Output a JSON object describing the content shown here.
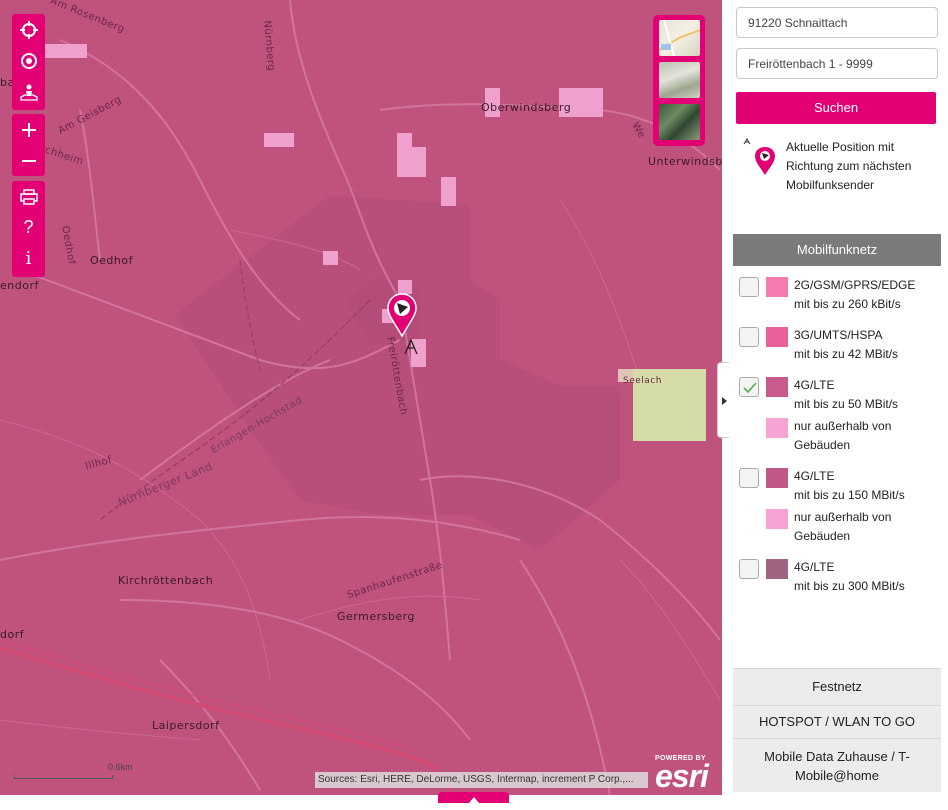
{
  "map": {
    "labels": {
      "am_rosenberg": "Am Rosenberg",
      "am_geisberg": "Am Geisberg",
      "nurnberg_top": "Nürnberg",
      "oberwindsberg": "Oberwindsberg",
      "unterwindsberg": "Unterwindsb",
      "we": "We",
      "oedhof_road": "Oedhof",
      "oedhof": "Oedhof",
      "endorf": "endorf",
      "freirottenbach": "Freiröttenbach",
      "seelach": "Seelach",
      "erlangen_hochstad": "Erlangen-Hochstad",
      "nurnberger_land": "Nürnberger Land",
      "illhof": "Illhof",
      "kirchrottenbach": "Kirchröttenbach",
      "spanhaufenstrasse": "Spanhaufenstraße",
      "germersberg": "Germersberg",
      "dorf": "dorf",
      "laipersdorf": "Laipersdorf",
      "bac": "bac",
      "rchheim": "rchheim"
    },
    "scale_label": "0.6km",
    "attribution": "Sources: Esri, HERE, DeLorme, USGS, Intermap, increment P Corp.,...",
    "esri_powered": "POWERED BY",
    "esri_logo": "esri",
    "controls": {
      "icons": [
        "locate-crosshair-icon",
        "target-icon",
        "map-person-icon",
        "zoom-in-icon",
        "zoom-out-icon",
        "print-icon",
        "help-icon",
        "info-icon"
      ],
      "help_glyph": "?",
      "info_glyph": "i"
    },
    "colors": {
      "coverage": "#c0527e",
      "highlight": "#f0a0cc",
      "seelach": "#d6dca8",
      "accent": "#e20074"
    }
  },
  "panel": {
    "search_value": "91220 Schnaittach",
    "street_value": "Freiröttenbach 1 - 9999",
    "search_button": "Suchen",
    "info_text": "Aktuelle Position mit Richtung zum nächsten Mobilfunksender",
    "section_title": "Mobilfunknetz",
    "legend": [
      {
        "title": "2G/GSM/GPRS/EDGE",
        "detail": "mit bis zu 260 kBit/s",
        "color": "#f57ab0",
        "checked": false
      },
      {
        "title": "3G/UMTS/HSPA",
        "detail": "mit bis zu 42 MBit/s",
        "color": "#e8609c",
        "checked": false
      },
      {
        "title": "4G/LTE",
        "detail": "mit bis zu 50 MBit/s",
        "color": "#c85b8e",
        "checked": true,
        "sub": "nur außerhalb von Gebäuden",
        "sub_color": "#f7a4d4"
      },
      {
        "title": "4G/LTE",
        "detail": "mit bis zu 150 MBit/s",
        "color": "#c2578a",
        "checked": false,
        "sub": "nur außerhalb von Gebäuden",
        "sub_color": "#f7a4d4"
      },
      {
        "title": "4G/LTE",
        "detail": "mit bis zu 300 MBit/s",
        "color": "#a06382",
        "checked": false
      }
    ],
    "festnetz": "Festnetz",
    "hotspot": "HOTSPOT / WLAN TO GO",
    "mobile_data": "Mobile Data Zuhause / T-Mobile@home"
  }
}
